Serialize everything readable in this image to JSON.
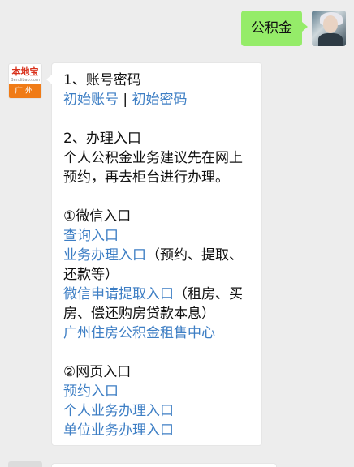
{
  "outgoing": {
    "text": "公积金",
    "avatar_icon": "user-avatar-photo"
  },
  "bot": {
    "avatar": {
      "logo": "本地宝",
      "site": "Bendibao.com",
      "city": "广州"
    }
  },
  "message": {
    "s1_title": "1、账号密码",
    "s1_link_account": "初始账号",
    "s1_sep": " | ",
    "s1_link_password": "初始密码",
    "s2_title": "2、办理入口",
    "s2_desc": "个人公积金业务建议先在网上预约，再去柜台进行办理。",
    "wechat_title": "①微信入口",
    "wechat_query": "查询入口",
    "wechat_business": "业务办理入口",
    "wechat_business_note": "（预约、提取、还款等）",
    "wechat_withdraw": "微信申请提取入口",
    "wechat_withdraw_note": "（租房、买房、偿还购房贷款本息）",
    "wechat_rental": "广州住房公积金租售中心",
    "web_title": "②网页入口",
    "web_booking": "预约入口",
    "web_personal": "个人业务办理入口",
    "web_unit": "单位业务办理入口"
  },
  "colors": {
    "background": "#ededed",
    "outgoing_bubble": "#95ec69",
    "link": "#3d7ec4",
    "bot_band": "#f07b16",
    "bot_logo": "#d9301b"
  }
}
